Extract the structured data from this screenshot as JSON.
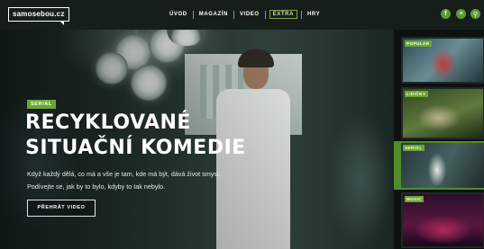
{
  "brand": {
    "logo_text": "samosebou.cz"
  },
  "nav": {
    "items": [
      {
        "label": "ÚVOD"
      },
      {
        "label": "MAGAZÍN"
      },
      {
        "label": "VIDEO"
      },
      {
        "label": "EXTRA",
        "active": true
      },
      {
        "label": "HRY"
      }
    ],
    "icons": [
      {
        "name": "facebook-icon",
        "glyph": "f"
      },
      {
        "name": "menu-icon",
        "glyph": "≡"
      },
      {
        "name": "search-icon",
        "glyph": "⚲"
      }
    ]
  },
  "hero": {
    "tag": "SERIÁL",
    "title_line1": "RECYKLOVANÉ",
    "title_line2": "SITUAČNÍ KOMEDIE",
    "description": "Když každý dělá, co má a vše je tam, kde má být, dává život smysl. Podívejte se, jak by to bylo, kdyby to tak nebylo.",
    "cta_label": "PŘEHRÁT VIDEO"
  },
  "sidebar": {
    "cards": [
      {
        "label": "POPULÁR"
      },
      {
        "label": "LIDIČKY"
      },
      {
        "label": "SERIÁL",
        "active": true
      },
      {
        "label": "MUSIC"
      }
    ]
  },
  "colors": {
    "accent": "#6aa62d",
    "nav_bg": "#161e1c",
    "sidebar_bg": "#0d110f"
  }
}
